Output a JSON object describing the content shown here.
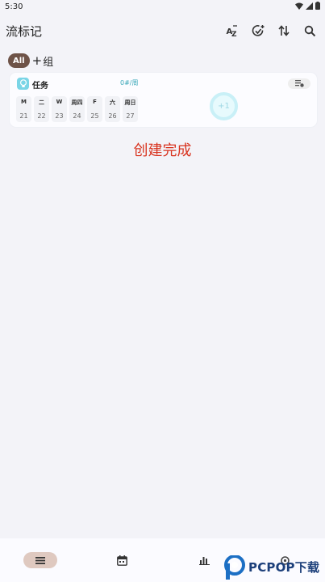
{
  "status_bar": {
    "time": "5:30"
  },
  "app_bar": {
    "title": "流标记",
    "sort_label": "AZ"
  },
  "groups": {
    "all": "All",
    "add_label": "组",
    "add_plus": "+"
  },
  "task": {
    "title": "任务",
    "count": "0#/周",
    "plus": "+1",
    "days": [
      {
        "name": "M",
        "date": "21"
      },
      {
        "name": "二",
        "date": "22"
      },
      {
        "name": "W",
        "date": "23"
      },
      {
        "name": "周四",
        "date": "24"
      },
      {
        "name": "F",
        "date": "25"
      },
      {
        "name": "六",
        "date": "26"
      },
      {
        "name": "周日",
        "date": "27"
      }
    ]
  },
  "overlay": {
    "message": "创建完成"
  },
  "watermark": {
    "text": "PCPOP下载"
  },
  "colors": {
    "accent_chip": "#6e5348",
    "nav_active": "#dfc9c0",
    "task_icon": "#7ad5e6",
    "overlay_text": "#d8331f"
  }
}
